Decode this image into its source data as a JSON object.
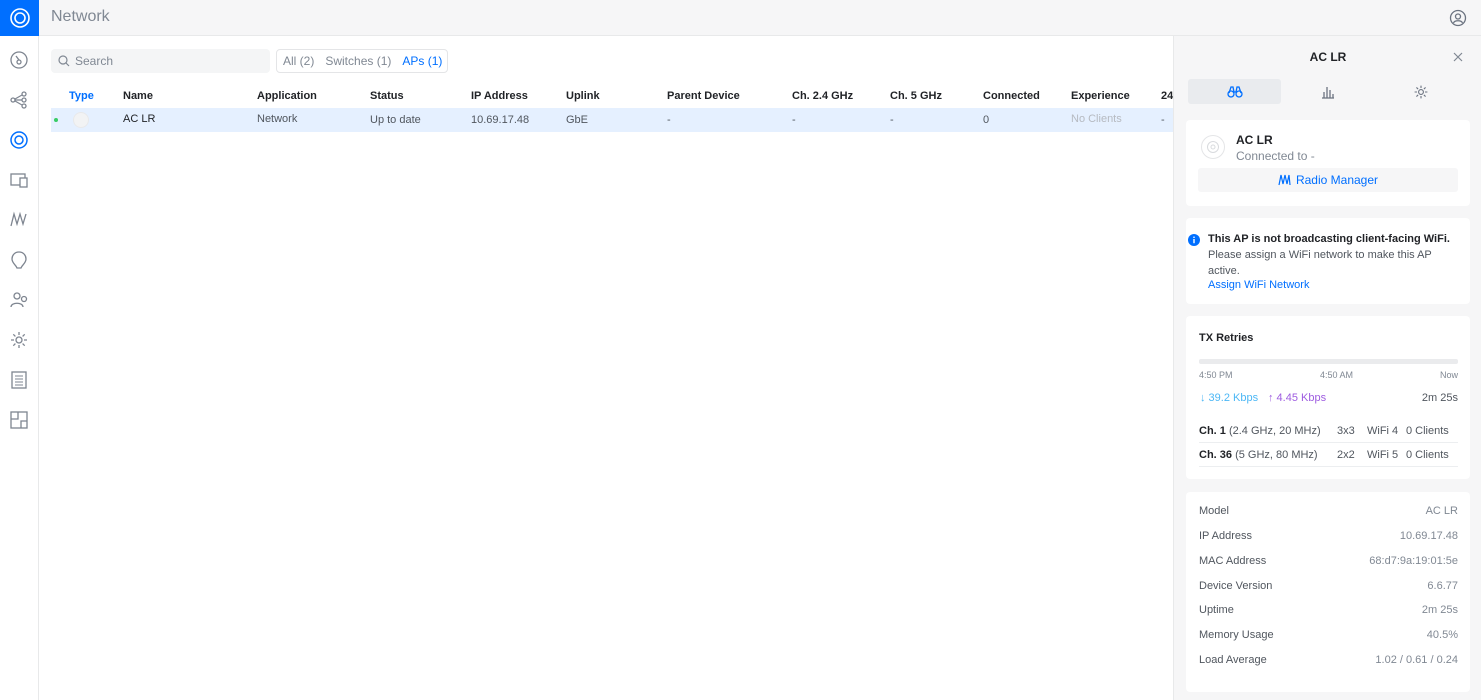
{
  "app": {
    "title": "Network"
  },
  "nav": {
    "items": [
      {
        "name": "dashboard"
      },
      {
        "name": "topology"
      },
      {
        "name": "devices"
      },
      {
        "name": "clients"
      },
      {
        "name": "statistics"
      },
      {
        "name": "insights"
      },
      {
        "name": "admins"
      },
      {
        "name": "settings"
      },
      {
        "name": "logs"
      },
      {
        "name": "floorplan"
      }
    ]
  },
  "search": {
    "placeholder": "Search"
  },
  "filters": [
    {
      "label": "All (2)"
    },
    {
      "label": "Switches (1)"
    },
    {
      "label": "APs (1)"
    }
  ],
  "table": {
    "columns": [
      "Type",
      "Name",
      "Application",
      "Status",
      "IP Address",
      "Uplink",
      "Parent Device",
      "Ch. 2.4 GHz",
      "Ch. 5 GHz",
      "Connected",
      "Experience",
      "24"
    ],
    "rows": [
      {
        "name": "AC LR",
        "application": "Network",
        "status": "Up to date",
        "ip": "10.69.17.48",
        "uplink": "GbE",
        "parent": "-",
        "ch24": "-",
        "ch5": "-",
        "connected": "0",
        "experience": "No Clients",
        "extra": "-"
      }
    ]
  },
  "panel": {
    "title": "AC LR",
    "device": {
      "name": "AC LR",
      "connected_to": "Connected to -"
    },
    "radio_manager_label": "Radio Manager",
    "notice": {
      "title": "This AP is not broadcasting client-facing WiFi.",
      "body": "Please assign a WiFi network to make this AP active.",
      "link": "Assign WiFi Network"
    },
    "tx": {
      "title": "TX Retries",
      "ticks": [
        "4:50 PM",
        "4:50 AM",
        "Now"
      ],
      "down": "↓ 39.2 Kbps",
      "up": "↑ 4.45 Kbps",
      "duration": "2m 25s",
      "channels": [
        {
          "ch": "Ch. 1",
          "detail": " (2.4 GHz, 20 MHz)",
          "mimo": "3x3",
          "std": "WiFi 4",
          "clients": "0 Clients"
        },
        {
          "ch": "Ch. 36",
          "detail": " (5 GHz, 80 MHz)",
          "mimo": "2x2",
          "std": "WiFi 5",
          "clients": "0 Clients"
        }
      ]
    },
    "properties": [
      {
        "key": "Model",
        "value": "AC LR"
      },
      {
        "key": "IP Address",
        "value": "10.69.17.48"
      },
      {
        "key": "MAC Address",
        "value": "68:d7:9a:19:01:5e"
      },
      {
        "key": "Device Version",
        "value": "6.6.77"
      },
      {
        "key": "Uptime",
        "value": "2m 25s"
      },
      {
        "key": "Memory Usage",
        "value": "40.5%"
      },
      {
        "key": "Load Average",
        "value": "1.02 / 0.61 / 0.24"
      }
    ]
  },
  "colors": {
    "accent": "#006fff",
    "online": "#38cc65",
    "download": "#4cb7f5",
    "upload": "#9e5ce0"
  }
}
